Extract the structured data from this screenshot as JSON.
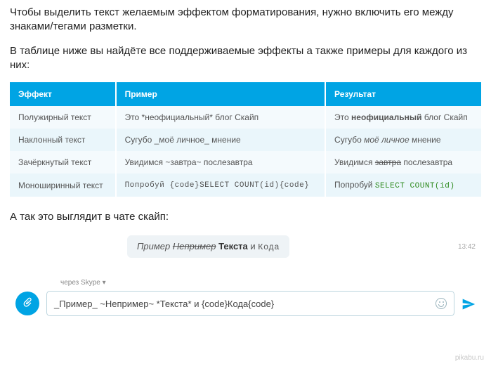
{
  "intro1": "Чтобы выделить текст желаемым эффектом форматирования, нужно включить его между знаками/тегами разметки.",
  "intro2": "В таблице ниже вы найдёте все поддерживаемые эффекты а также примеры для каждого из них:",
  "table": {
    "headers": {
      "c1": "Эффект",
      "c2": "Пример",
      "c3": "Результат"
    },
    "rows": {
      "r1": {
        "effect": "Полужирный текст",
        "example": "Это *неофициальный* блог Скайп",
        "res_a": "Это ",
        "res_b": "неофициальный",
        "res_c": " блог Скайп"
      },
      "r2": {
        "effect": "Наклонный текст",
        "example": "Сугубо _моё личное_ мнение",
        "res_a": "Сугубо ",
        "res_b": "моё личное",
        "res_c": " мнение"
      },
      "r3": {
        "effect": "Зачёркнутый текст",
        "example": "Увидимся ~завтра~ послезавтра",
        "res_a": "Увидимся ",
        "res_b": "завтра",
        "res_c": " послезавтра"
      },
      "r4": {
        "effect": "Моноширинный текст",
        "example": "Попробуй {code}SELECT COUNT(id){code}",
        "res_a": "Попробуй ",
        "res_b": "SELECT COUNT(id)",
        "res_c": ""
      }
    }
  },
  "after": "А так это выглядит в чате скайп:",
  "chat": {
    "bubble": {
      "a": "Пример ",
      "b": "Непример",
      "c": " Текста",
      "d": " и ",
      "e": "Кода"
    },
    "time": "13:42",
    "via": "через Skype ▾",
    "input": "_Пример_ ~Непример~ *Текста* и {code}Кода{code}"
  },
  "watermark": "pikabu.ru"
}
